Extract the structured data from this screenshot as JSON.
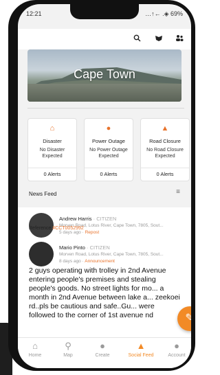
{
  "status": {
    "time": "12:21",
    "right": "…↑← .◈ 69%"
  },
  "banner": {
    "title": "Cape Town"
  },
  "cards": [
    {
      "icon": "house-alert-icon",
      "title": "Disaster",
      "desc": "No Disaster Expected",
      "alerts": "0 Alerts"
    },
    {
      "icon": "bulb-icon",
      "title": "Power Outage",
      "desc": "No Power Outage Expected",
      "alerts": "0 Alerts"
    },
    {
      "icon": "road-worker-icon",
      "title": "Road Closure",
      "desc": "No Road Closure Expected",
      "alerts": "0 Alerts"
    }
  ],
  "newsfeed": {
    "label": "News Feed"
  },
  "posts": [
    {
      "name": "Andrew Harris",
      "role": "CITIZEN",
      "address": "Morven Road, Lotus River, Cape Town, 7805, Sout...",
      "time": "5 days ago",
      "tag": "Repost",
      "ref_label": "Reference",
      "ref_id": "#CCT0052992"
    },
    {
      "name": "Mario Pinto",
      "role": "CITIZEN",
      "address": "Morven Road, Lotus River, Cape Town, 7805, Sout...",
      "time": "8 days ago",
      "tag": "Announcement",
      "text": "2 guys operating with trolley in 2nd Avenue entering people's premises and stealing people's goods. No street lights for mo... a month in 2nd Avenue between lake a... zeekoei rd..pls be cautious and safe..Gu... were followed to the corner of 1st avenue nd"
    }
  ],
  "nav": {
    "home": "Home",
    "map": "Map",
    "create": "Create",
    "social": "Social Feed",
    "account": "Account"
  },
  "colors": {
    "accent": "#f28a26"
  }
}
